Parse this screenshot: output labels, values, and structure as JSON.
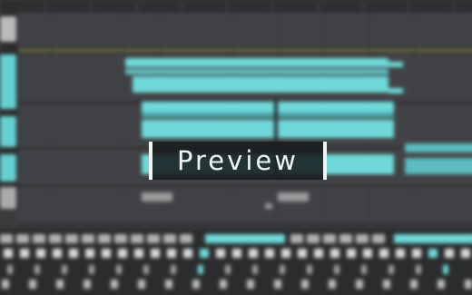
{
  "overlay": {
    "label": "Preview"
  },
  "colors": {
    "accent_clip": "#6fd8d9",
    "background": "#3b3c3e",
    "automation_line": "#8e8a3e",
    "overlay_border": "#f2f4f4"
  },
  "icons": [
    "preview-frame-bracket-icon"
  ]
}
